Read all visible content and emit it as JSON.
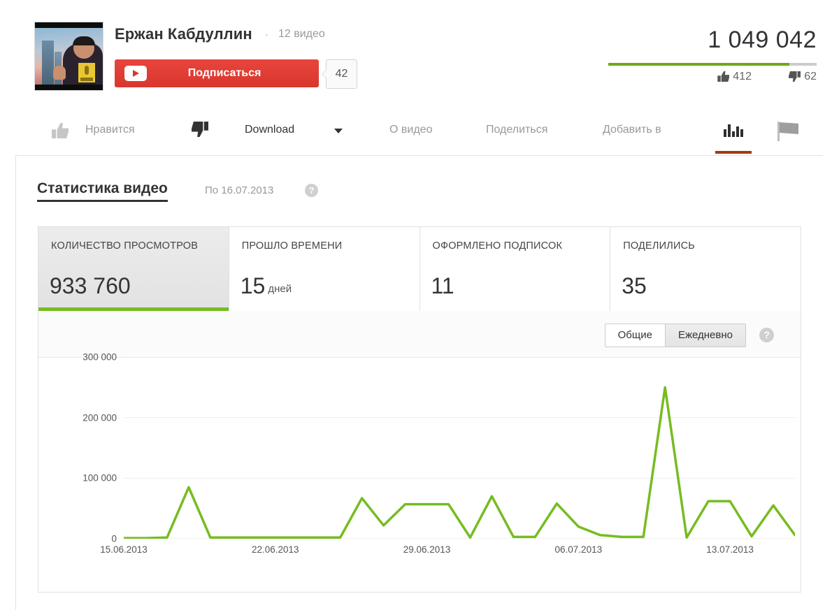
{
  "channel": {
    "name": "Ержан Кабдуллин",
    "separator": "·",
    "video_count": "12 видео",
    "subscribe_label": "Подписаться",
    "subscriber_count": "42",
    "avatar_alt": "channel-avatar"
  },
  "video_stats": {
    "views": "1 049 042",
    "likes": "412",
    "dislikes": "62",
    "like_ratio_percent": 87
  },
  "action_bar": {
    "like_label": "Нравится",
    "download_label": "Download",
    "about_label": "О видео",
    "share_label": "Поделиться",
    "add_to_label": "Добавить в",
    "statistics_icon": "bar-chart-icon",
    "report_icon": "flag-icon"
  },
  "statistics": {
    "title": "Статистика видео",
    "date_note": "По 16.07.2013",
    "help_glyph": "?",
    "cards": [
      {
        "label": "КОЛИЧЕСТВО ПРОСМОТРОВ",
        "value": "933 760",
        "unit": "",
        "active": true
      },
      {
        "label": "ПРОШЛО ВРЕМЕНИ",
        "value": "15",
        "unit": "дней",
        "active": false
      },
      {
        "label": "ОФОРМЛЕНО ПОДПИСОК",
        "value": "11",
        "unit": "",
        "active": false
      },
      {
        "label": "ПОДЕЛИЛИСЬ",
        "value": "35",
        "unit": "",
        "active": false
      }
    ],
    "toggle": {
      "cumulative_label": "Общие",
      "daily_label": "Ежедневно",
      "selected": "Ежедневно"
    }
  },
  "colors": {
    "green_line": "#76bc21",
    "subscribe_red": "#d8372e",
    "active_tab_underline": "#a5390e",
    "grid": "#ededed"
  },
  "chart_data": {
    "type": "line",
    "title": "",
    "xlabel": "",
    "ylabel": "",
    "ylim": [
      0,
      300000
    ],
    "yticks": [
      0,
      100000,
      200000,
      300000
    ],
    "ytick_labels": [
      "0",
      "100 000",
      "200 000",
      "300 000"
    ],
    "grid": true,
    "legend": "none",
    "xtick_labels": [
      "15.06.2013",
      "22.06.2013",
      "29.06.2013",
      "06.07.2013",
      "13.07.2013"
    ],
    "xtick_indices": [
      0,
      7,
      14,
      21,
      28
    ],
    "x": [
      "15.06.2013",
      "16.06.2013",
      "17.06.2013",
      "18.06.2013",
      "19.06.2013",
      "20.06.2013",
      "21.06.2013",
      "22.06.2013",
      "23.06.2013",
      "24.06.2013",
      "25.06.2013",
      "26.06.2013",
      "27.06.2013",
      "28.06.2013",
      "29.06.2013",
      "30.06.2013",
      "01.07.2013",
      "02.07.2013",
      "03.07.2013",
      "04.07.2013",
      "05.07.2013",
      "06.07.2013",
      "07.07.2013",
      "08.07.2013",
      "09.07.2013",
      "10.07.2013",
      "11.07.2013",
      "12.07.2013",
      "13.07.2013",
      "14.07.2013",
      "15.07.2013",
      "16.07.2013"
    ],
    "values": [
      1000,
      1000,
      2000,
      85000,
      2000,
      2000,
      2000,
      2000,
      2000,
      2000,
      2000,
      67000,
      22000,
      57000,
      57000,
      57000,
      2000,
      70000,
      3000,
      3000,
      58000,
      20000,
      6000,
      3000,
      3000,
      250000,
      2000,
      62000,
      62000,
      4000,
      55000,
      6000
    ],
    "series_name": "Количество просмотров"
  }
}
